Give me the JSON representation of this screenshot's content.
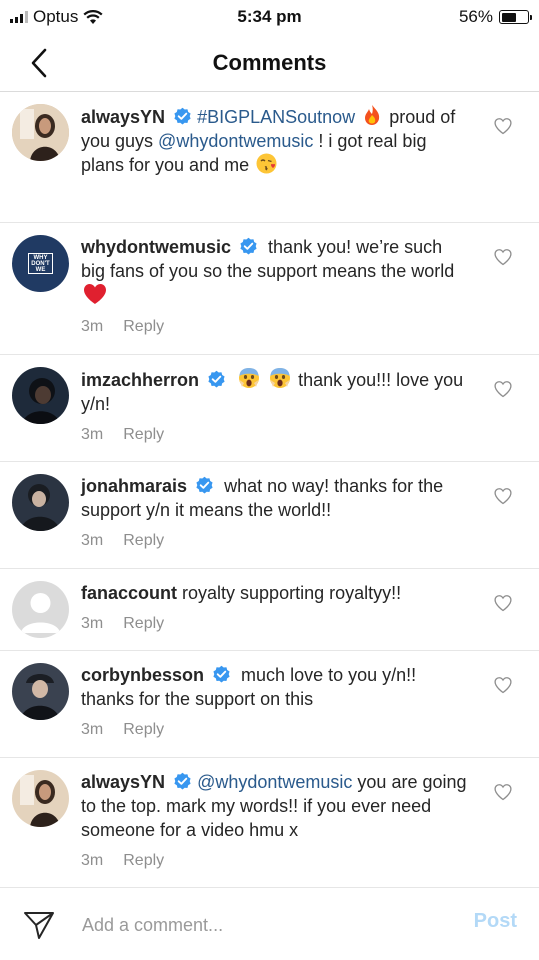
{
  "status_bar": {
    "carrier": "Optus",
    "time": "5:34 pm",
    "battery": "56%",
    "battery_level": 0.56
  },
  "header": {
    "title": "Comments"
  },
  "comments": [
    {
      "username": "alwaysYN",
      "verified": true,
      "link": "#BIGPLANSoutnow",
      "text_a": "proud of you guys ",
      "mention": "@whydontwemusic",
      "text_b": " ! i got real big plans for you and me",
      "emojis": [
        "fire",
        "kissing-heart"
      ]
    },
    {
      "username": "whydontwemusic",
      "verified": true,
      "text": " thank you! we’re such big fans of you so the support means the world",
      "emojis": [
        "red-heart"
      ],
      "avatar_text": "WHY DON'T WE",
      "time": "3m",
      "reply": "Reply"
    },
    {
      "username": "imzachherron",
      "verified": true,
      "text": " thank you!!! love you y/n!",
      "emojis": [
        "screaming-face",
        "screaming-face"
      ],
      "time": "3m",
      "reply": "Reply"
    },
    {
      "username": "jonahmarais",
      "verified": true,
      "text": " what no way! thanks for the support y/n it means the world!!",
      "time": "3m",
      "reply": "Reply"
    },
    {
      "username": "fanaccount",
      "verified": false,
      "text": " royalty supporting royaltyy!!",
      "time": "3m",
      "reply": "Reply"
    },
    {
      "username": "corbynbesson",
      "verified": true,
      "text": " much love to you y/n!! thanks for the support on this",
      "time": "3m",
      "reply": "Reply"
    },
    {
      "username": "alwaysYN",
      "verified": true,
      "mention": "@whydontwemusic",
      "text": " you are going to the top. mark my words!! if you ever need someone for a video hmu x",
      "time": "3m",
      "reply": "Reply"
    }
  ],
  "composer": {
    "placeholder": "Add a comment...",
    "post_label": "Post"
  },
  "colors": {
    "link": "#2a5a8c",
    "verified": "#3897f0",
    "post_disabled": "#b3d9f7",
    "meta": "#8e8e8e"
  }
}
